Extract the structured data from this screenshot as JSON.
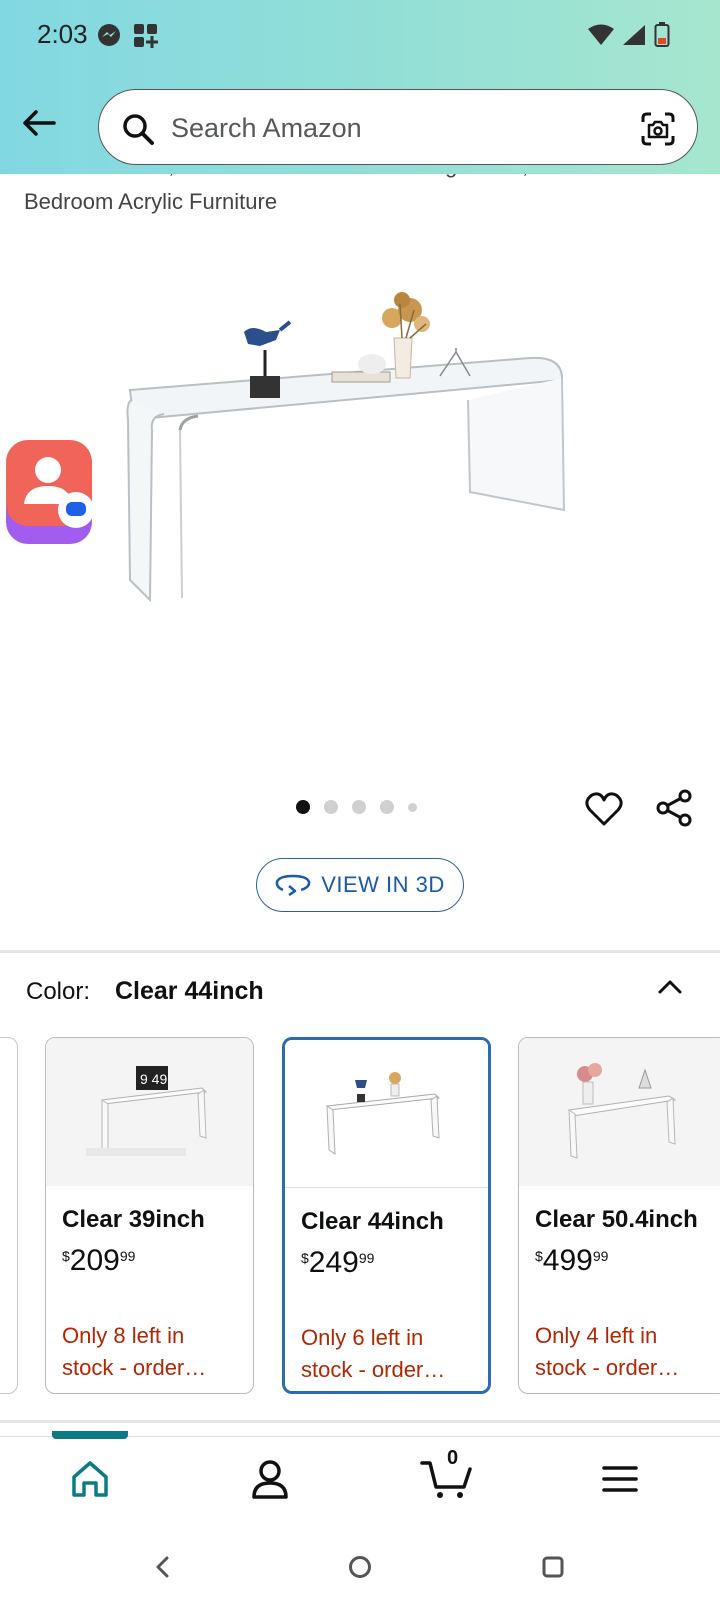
{
  "status_bar": {
    "time": "2:03",
    "left_icons": [
      "messenger-icon",
      "widget-plus-icon"
    ],
    "right_icons": [
      "wifi-icon",
      "signal-icon",
      "battery-icon"
    ]
  },
  "header": {
    "back_icon": "back-arrow-icon",
    "search_placeholder": "Search Amazon",
    "camera_icon": "camera-scan-icon",
    "gradient_colors": [
      "#82d8e2",
      "#a6e6cf"
    ]
  },
  "product": {
    "title_partial": "Waterfall Table,Lucite Coffee Table for Living Room, Office and",
    "title_line2": "Bedroom Acrylic Furniture",
    "image_count": 5,
    "active_image_index": 0,
    "view_3d_label": "VIEW IN 3D"
  },
  "color": {
    "label": "Color:",
    "selected": "Clear 44inch"
  },
  "swatches": [
    {
      "name": "Clear 39inch",
      "price_symbol": "$",
      "price_whole": "209",
      "price_fraction": "99",
      "stock_line1": "Only 8 left in",
      "stock_line2": "stock - order…",
      "selected": false
    },
    {
      "name": "Clear 44inch",
      "price_symbol": "$",
      "price_whole": "249",
      "price_fraction": "99",
      "stock_line1": "Only 6 left in",
      "stock_line2": "stock - order…",
      "selected": true
    },
    {
      "name": "Clear 50.4inch",
      "price_symbol": "$",
      "price_whole": "499",
      "price_fraction": "99",
      "stock_line1": "Only 4 left in",
      "stock_line2": "stock - order…",
      "selected": false
    }
  ],
  "bottom_nav": {
    "items": [
      "home-icon",
      "account-icon",
      "cart-icon",
      "menu-icon"
    ],
    "cart_count": "0",
    "active": "home",
    "accent_color": "#0d7a86"
  },
  "accent": {
    "link_blue": "#1a5aa8",
    "stock_red": "#b12704"
  }
}
